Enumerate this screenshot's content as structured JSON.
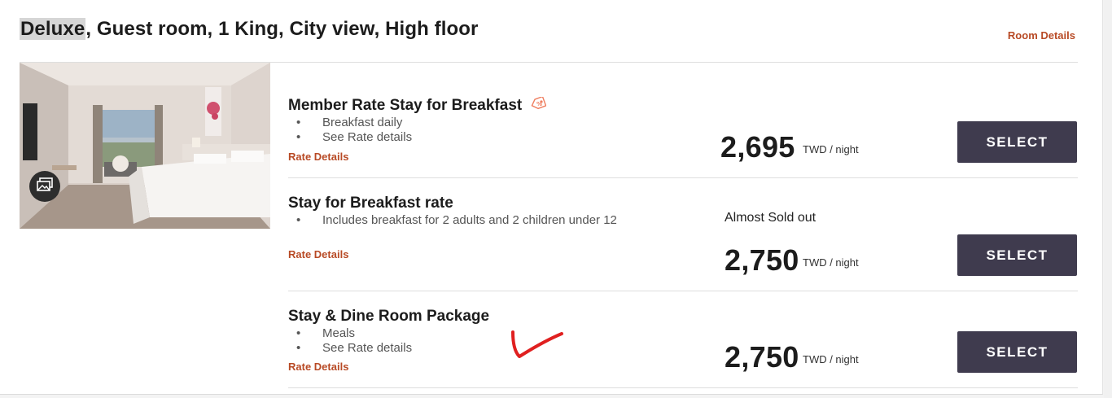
{
  "room": {
    "title_highlight": "Deluxe",
    "title_rest": ", Guest room, 1 King, City view, High floor",
    "details_link": "Room Details"
  },
  "rates": [
    {
      "name": "Member Rate Stay for Breakfast",
      "has_member_tag": true,
      "features": [
        "Breakfast daily",
        "See Rate details"
      ],
      "details_link": "Rate Details",
      "status": "",
      "price": "2,695",
      "unit": "TWD / night",
      "button": "SELECT"
    },
    {
      "name": "Stay for Breakfast rate",
      "has_member_tag": false,
      "features": [
        "Includes breakfast for 2 adults and 2 children under 12"
      ],
      "details_link": "Rate Details",
      "status": "Almost Sold out",
      "price": "2,750",
      "unit": "TWD / night",
      "button": "SELECT"
    },
    {
      "name": "Stay & Dine Room Package",
      "has_member_tag": false,
      "features": [
        "Meals",
        "See Rate details"
      ],
      "details_link": "Rate Details",
      "status": "",
      "price": "2,750",
      "unit": "TWD / night",
      "button": "SELECT"
    }
  ],
  "colors": {
    "accent_link": "#b84a25",
    "button_bg": "#3f3b4e",
    "annotation": "#e02020"
  },
  "icons": {
    "gallery": "photo-gallery-icon",
    "member_tag": "tag-icon"
  }
}
